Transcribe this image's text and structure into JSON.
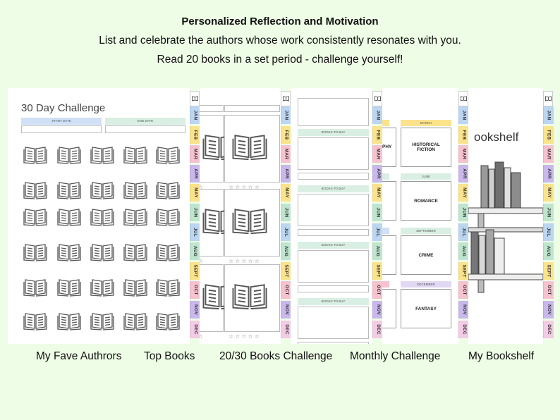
{
  "header": {
    "title": "Personalized Reflection and Motivation",
    "line1": "List and celebrate the authors whose work consistently resonates with you.",
    "line2": "Read 20 books in a set period - challenge yourself!"
  },
  "months": [
    "JAN",
    "FEB",
    "MAR",
    "APR",
    "MAY",
    "JUN",
    "JUL",
    "AUG",
    "SEPT",
    "OCT",
    "NOV",
    "DEC"
  ],
  "month_colors": [
    "#bcd6f2",
    "#fbe38b",
    "#f7c2cf",
    "#c9b8ec",
    "#fbe38b",
    "#bfe5cf",
    "#bcd6f2",
    "#bfe5cf",
    "#fbe38b",
    "#f7c2cf",
    "#c9b8ec",
    "#f3cbe4"
  ],
  "captions": [
    "My Fave Authrors",
    "Top Books",
    "20/30 Books Challenge",
    "Monthly Challenge",
    "My Bookshelf"
  ],
  "page1": {
    "title": "30 Day Challenge",
    "start_label": "START DATE",
    "end_label": "END DATE"
  },
  "page3": {
    "books_to_buy": "BOOKS TO BUY"
  },
  "page4": {
    "left_fragment": "PHY",
    "headers": [
      "MARCH",
      "JUNE",
      "SEPTEMBER",
      "DECEMBER"
    ],
    "genres": [
      "HISTORICAL FICTION",
      "ROMANCE",
      "CRIME",
      "FANTASY"
    ]
  },
  "page5": {
    "title_fragment": "ookshelf"
  }
}
